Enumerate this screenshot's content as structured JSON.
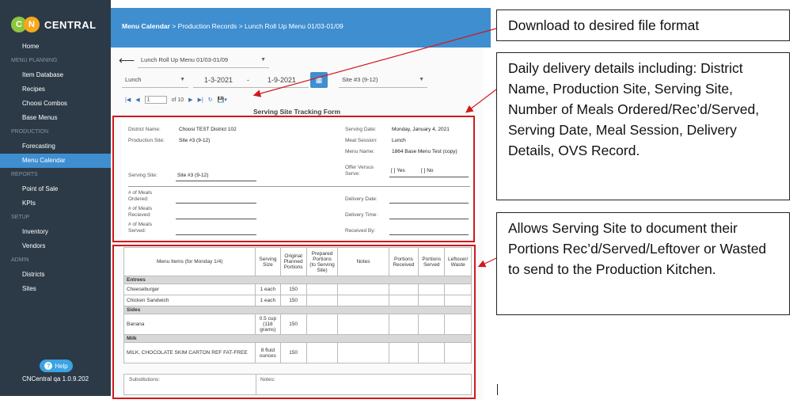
{
  "sidebar": {
    "logo": {
      "c": "C",
      "n": "N",
      "text": "CENTRAL"
    },
    "nav": [
      {
        "type": "item",
        "label": "Home",
        "cls": "top"
      },
      {
        "type": "section",
        "label": "MENU PLANNING"
      },
      {
        "type": "item",
        "label": "Item Database"
      },
      {
        "type": "item",
        "label": "Recipes"
      },
      {
        "type": "item",
        "label": "Choosi Combos"
      },
      {
        "type": "item",
        "label": "Base Menus"
      },
      {
        "type": "section",
        "label": "PRODUCTION"
      },
      {
        "type": "item",
        "label": "Forecasting"
      },
      {
        "type": "item",
        "label": "Menu Calendar",
        "active": true
      },
      {
        "type": "section",
        "label": "REPORTS"
      },
      {
        "type": "item",
        "label": "Point of Sale"
      },
      {
        "type": "item",
        "label": "KPIs"
      },
      {
        "type": "section",
        "label": "SETUP"
      },
      {
        "type": "item",
        "label": "Inventory"
      },
      {
        "type": "item",
        "label": "Vendors"
      },
      {
        "type": "section",
        "label": "ADMIN"
      },
      {
        "type": "item",
        "label": "Districts"
      },
      {
        "type": "item",
        "label": "Sites"
      }
    ],
    "help_label": "Help",
    "version": "CNCentral qa 1.0.9.202"
  },
  "header": {
    "crumb1": "Menu Calendar",
    "sep": ">",
    "crumb2": "Production Records",
    "crumb3": "Lunch Roll Up Menu 01/03-01/09"
  },
  "controls": {
    "menu_select": "Lunch Roll Up Menu 01/03-01/09",
    "meal_select": "Lunch",
    "date_start": "1-3-2021",
    "date_sep": "-",
    "date_end": "1-9-2021",
    "site_select": "Site #3 (9-12)"
  },
  "toolbar": {
    "page_value": "1",
    "page_of": "of 10"
  },
  "form": {
    "title": "Serving Site Tracking Form",
    "district_label": "District Name:",
    "district_value": "Choosi TEST District 102",
    "production_label": "Production Site:",
    "production_value": "Site #3 (9-12)",
    "serving_site_label": "Serving Site:",
    "serving_site_value": "Site #3 (9-12)",
    "serving_date_label": "Serving Date:",
    "serving_date_value": "Monday, January 4, 2021",
    "meal_session_label": "Meal Session:",
    "meal_session_value": "Lunch",
    "menu_name_label": "Menu Name:",
    "menu_name_value": "1864 Base Menu Test (copy)",
    "ovs_label_1": "Offer Versus",
    "ovs_label_2": "Serve:",
    "ovs_yes": "[  ] Yes",
    "ovs_no": "[  ] No",
    "meals_ordered_1": "# of Meals",
    "meals_ordered_2": "Ordered:",
    "meals_received_1": "# of Meals",
    "meals_received_2": "Recieved:",
    "meals_served_1": "# of Meals",
    "meals_served_2": "Served:",
    "delivery_date_label": "Delivery Date:",
    "delivery_time_label": "Delivery Time:",
    "received_by_label": "Received By:"
  },
  "table": {
    "headers": [
      "Menu Items (for Monday 1/4)",
      "Serving Size",
      "Original Planned Portions",
      "Prepared Portions (to Serving Site)",
      "Notes",
      "Portions Received",
      "Portions Served",
      "Leftover/ Waste"
    ],
    "groups": [
      {
        "category": "Entrees",
        "rows": [
          {
            "item": "Cheeseburger",
            "size": "1 each",
            "portions": "150"
          },
          {
            "item": "Chicken Sandwich",
            "size": "1 each",
            "portions": "150"
          }
        ]
      },
      {
        "category": "Sides",
        "rows": [
          {
            "item": "Banana",
            "size": "0.5 cup (118 grams)",
            "portions": "150"
          }
        ]
      },
      {
        "category": "Milk",
        "rows": [
          {
            "item": "MILK, CHOCOLATE SKIM CARTON REF FAT-FREE",
            "size": "8 fluid ounces",
            "portions": "150"
          }
        ]
      }
    ],
    "substitutions_label": "Substitutions:",
    "notes_label": "Notes:"
  },
  "callouts": {
    "download": "Download to desired file format",
    "delivery": "Daily delivery details including: District Name, Production Site, Serving Site, Number of Meals Ordered/Rec’d/Served, Serving Date, Meal Session, Delivery Details, OVS Record.",
    "portions": "Allows Serving Site to document their Portions Rec’d/Served/Leftover or Wasted to send to the Production Kitchen."
  },
  "colors": {
    "sidebar_bg": "#2c3a47",
    "accent": "#3e8ed0",
    "highlight_red": "#d0191d",
    "logo_green": "#8cc63f",
    "logo_orange": "#f7a81b"
  }
}
